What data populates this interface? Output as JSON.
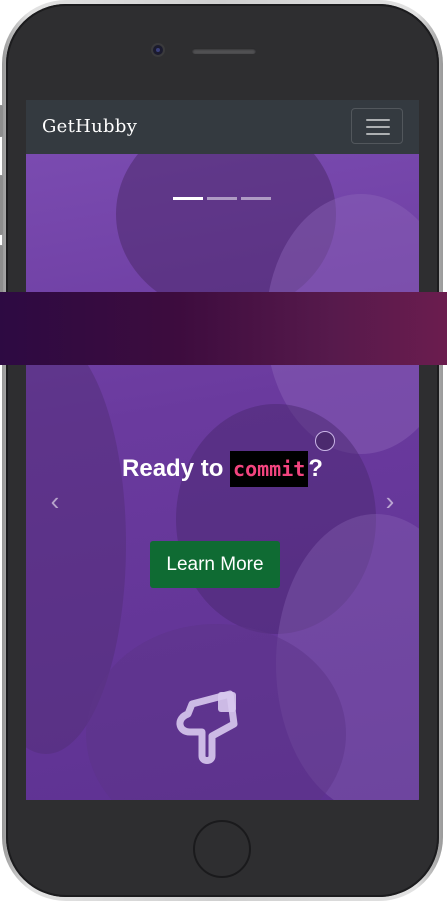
{
  "navbar": {
    "brand": "GetHubby",
    "toggler_icon": "hamburger-icon"
  },
  "carousel": {
    "indicator_count": 3,
    "active_index": 0,
    "prev_icon": "chevron-left-icon",
    "next_icon": "chevron-right-icon",
    "prev_glyph": "‹",
    "next_glyph": "›"
  },
  "hero": {
    "headline_prefix": "Ready to ",
    "headline_code": "commit",
    "headline_suffix": "?",
    "cta_label": "Learn More",
    "pointer_icon": "hand-pointing-down-icon"
  },
  "colors": {
    "navbar_bg": "#343a40",
    "hero_overlay": "#6e3fa0",
    "code_text": "#f2447e",
    "cta_bg": "#0f6b33"
  }
}
